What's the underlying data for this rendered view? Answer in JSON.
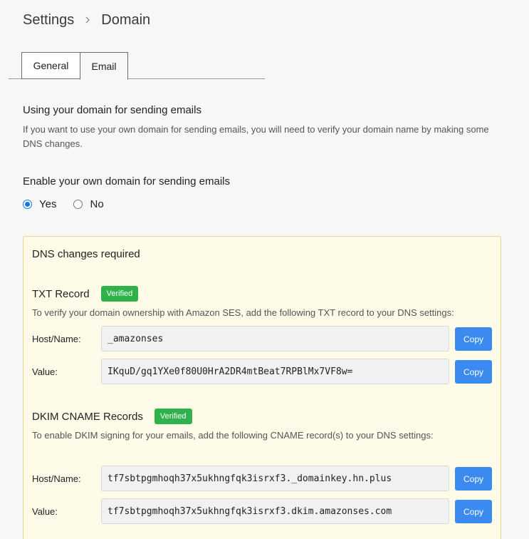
{
  "breadcrumb": {
    "parent": "Settings",
    "current": "Domain"
  },
  "tabs": [
    {
      "label": "General",
      "active": false
    },
    {
      "label": "Email",
      "active": true
    }
  ],
  "intro": {
    "title": "Using your domain for sending emails",
    "description": "If you want to use your own domain for sending emails, you will need to verify your domain name by making some DNS changes."
  },
  "enable": {
    "title": "Enable your own domain for sending emails",
    "options": [
      {
        "label": "Yes",
        "checked": true
      },
      {
        "label": "No",
        "checked": false
      }
    ]
  },
  "dns": {
    "heading": "DNS changes required",
    "txt": {
      "title": "TXT Record",
      "badge": "Verified",
      "description": "To verify your domain ownership with Amazon SES, add the following TXT record to your DNS settings:",
      "host_label": "Host/Name:",
      "host_value": "_amazonses",
      "value_label": "Value:",
      "value_value": "IKquD/gq1YXe0f80U0HrA2DR4mtBeat7RPBlMx7VF8w="
    },
    "dkim": {
      "title": "DKIM CNAME Records",
      "badge": "Verified",
      "description": "To enable DKIM signing for your emails, add the following CNAME record(s) to your DNS settings:",
      "host_label": "Host/Name:",
      "host_value": "tf7sbtpgmhoqh37x5ukhngfqk3isrxf3._domainkey.hn.plus",
      "value_label": "Value:",
      "value_value": "tf7sbtpgmhoqh37x5ukhngfqk3isrxf3.dkim.amazonses.com"
    },
    "copy_label": "Copy"
  },
  "colors": {
    "badge": "#2fb24c",
    "copy_button": "#3a8aef",
    "radio_accent": "#1a73e8",
    "dns_box_bg": "#fefbe8"
  }
}
